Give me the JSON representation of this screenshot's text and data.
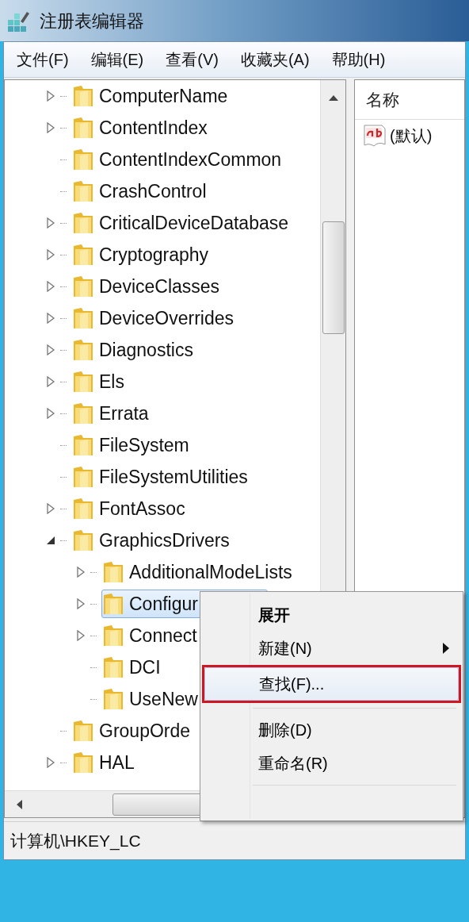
{
  "window": {
    "title": "注册表编辑器"
  },
  "menu": [
    "文件(F)",
    "编辑(E)",
    "查看(V)",
    "收藏夹(A)",
    "帮助(H)"
  ],
  "tree": [
    {
      "label": "ComputerName",
      "expandable": true,
      "expanded": false,
      "selected": false
    },
    {
      "label": "ContentIndex",
      "expandable": true,
      "expanded": false,
      "selected": false
    },
    {
      "label": "ContentIndexCommon",
      "expandable": false,
      "selected": false
    },
    {
      "label": "CrashControl",
      "expandable": false,
      "selected": false
    },
    {
      "label": "CriticalDeviceDatabase",
      "expandable": true,
      "expanded": false,
      "selected": false
    },
    {
      "label": "Cryptography",
      "expandable": true,
      "expanded": false,
      "selected": false
    },
    {
      "label": "DeviceClasses",
      "expandable": true,
      "expanded": false,
      "selected": false
    },
    {
      "label": "DeviceOverrides",
      "expandable": true,
      "expanded": false,
      "selected": false
    },
    {
      "label": "Diagnostics",
      "expandable": true,
      "expanded": false,
      "selected": false
    },
    {
      "label": "Els",
      "expandable": true,
      "expanded": false,
      "selected": false
    },
    {
      "label": "Errata",
      "expandable": true,
      "expanded": false,
      "selected": false
    },
    {
      "label": "FileSystem",
      "expandable": false,
      "selected": false
    },
    {
      "label": "FileSystemUtilities",
      "expandable": false,
      "selected": false
    },
    {
      "label": "FontAssoc",
      "expandable": true,
      "expanded": false,
      "selected": false
    },
    {
      "label": "GraphicsDrivers",
      "expandable": true,
      "expanded": true,
      "selected": false,
      "children": [
        {
          "label": "AdditionalModeLists",
          "expandable": true,
          "expanded": false,
          "selected": false
        },
        {
          "label": "Configur",
          "expandable": true,
          "expanded": false,
          "selected": true
        },
        {
          "label": "Connect",
          "expandable": true,
          "expanded": false,
          "selected": false
        },
        {
          "label": "DCI",
          "expandable": false,
          "selected": false
        },
        {
          "label": "UseNew",
          "expandable": false,
          "selected": false
        }
      ]
    },
    {
      "label": "GroupOrde",
      "expandable": false,
      "selected": false
    },
    {
      "label": "HAL",
      "expandable": true,
      "expanded": false,
      "selected": false
    }
  ],
  "list": {
    "columns": [
      "名称"
    ],
    "rows": [
      {
        "name": "(默认)"
      }
    ]
  },
  "context_menu": [
    {
      "label": "展开",
      "kind": "default",
      "selected": false,
      "outlined": false
    },
    {
      "label": "新建(N)",
      "kind": "submenu",
      "selected": false,
      "outlined": false
    },
    {
      "label": "查找(F)...",
      "kind": "item",
      "selected": true,
      "outlined": true
    },
    {
      "kind": "separator"
    },
    {
      "label": "删除(D)",
      "kind": "item",
      "selected": false,
      "outlined": false
    },
    {
      "label": "重命名(R)",
      "kind": "item",
      "selected": false,
      "outlined": false
    },
    {
      "kind": "separator"
    }
  ],
  "status_bar": {
    "path": "计算机\\HKEY_LC"
  }
}
